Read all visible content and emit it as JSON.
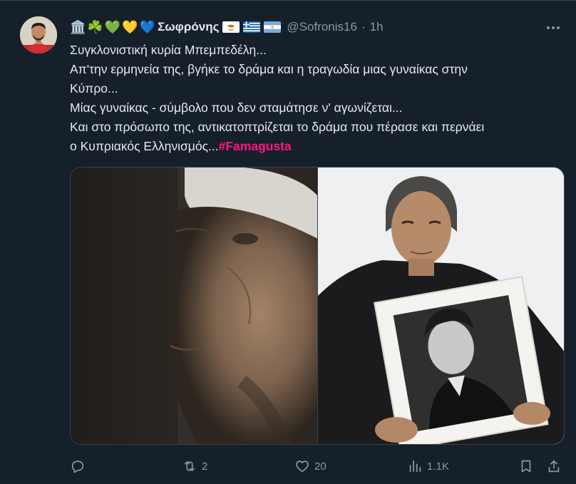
{
  "author": {
    "emoji_prefix": [
      "🏛️",
      "☘️",
      "💚",
      "💛",
      "💙"
    ],
    "name": "Σωφρόνης",
    "flags": [
      "cyprus-flag",
      "greece-flag",
      "argentina-flag"
    ],
    "handle": "@Sofronis16",
    "separator": "·",
    "time": "1h"
  },
  "tweet": {
    "lines": [
      "Συγκλονιστική κυρία Μπεμπεδέλη...",
      "Απ'την ερμηνεία της, βγήκε το δράμα και η τραγωδία μιας γυναίκας στην",
      "Κύπρο...",
      "Μίας γυναίκας - σύμβολο που δεν σταμάτησε ν' αγωνίζεται...",
      "Και στο πρόσωπο της, αντικατοπτρίζεται το δράμα που πέρασε και περνάει",
      "ο Κυπριακός Ελληνισμός..."
    ],
    "hashtag": "#Famagusta"
  },
  "actions": {
    "reply_count": "",
    "retweet_count": "2",
    "like_count": "20",
    "views_count": "1.1K"
  },
  "colors": {
    "background": "#15202b",
    "text": "#e7e9ea",
    "muted": "#8b98a5",
    "hashtag": "#f91880",
    "border": "#38444d"
  }
}
